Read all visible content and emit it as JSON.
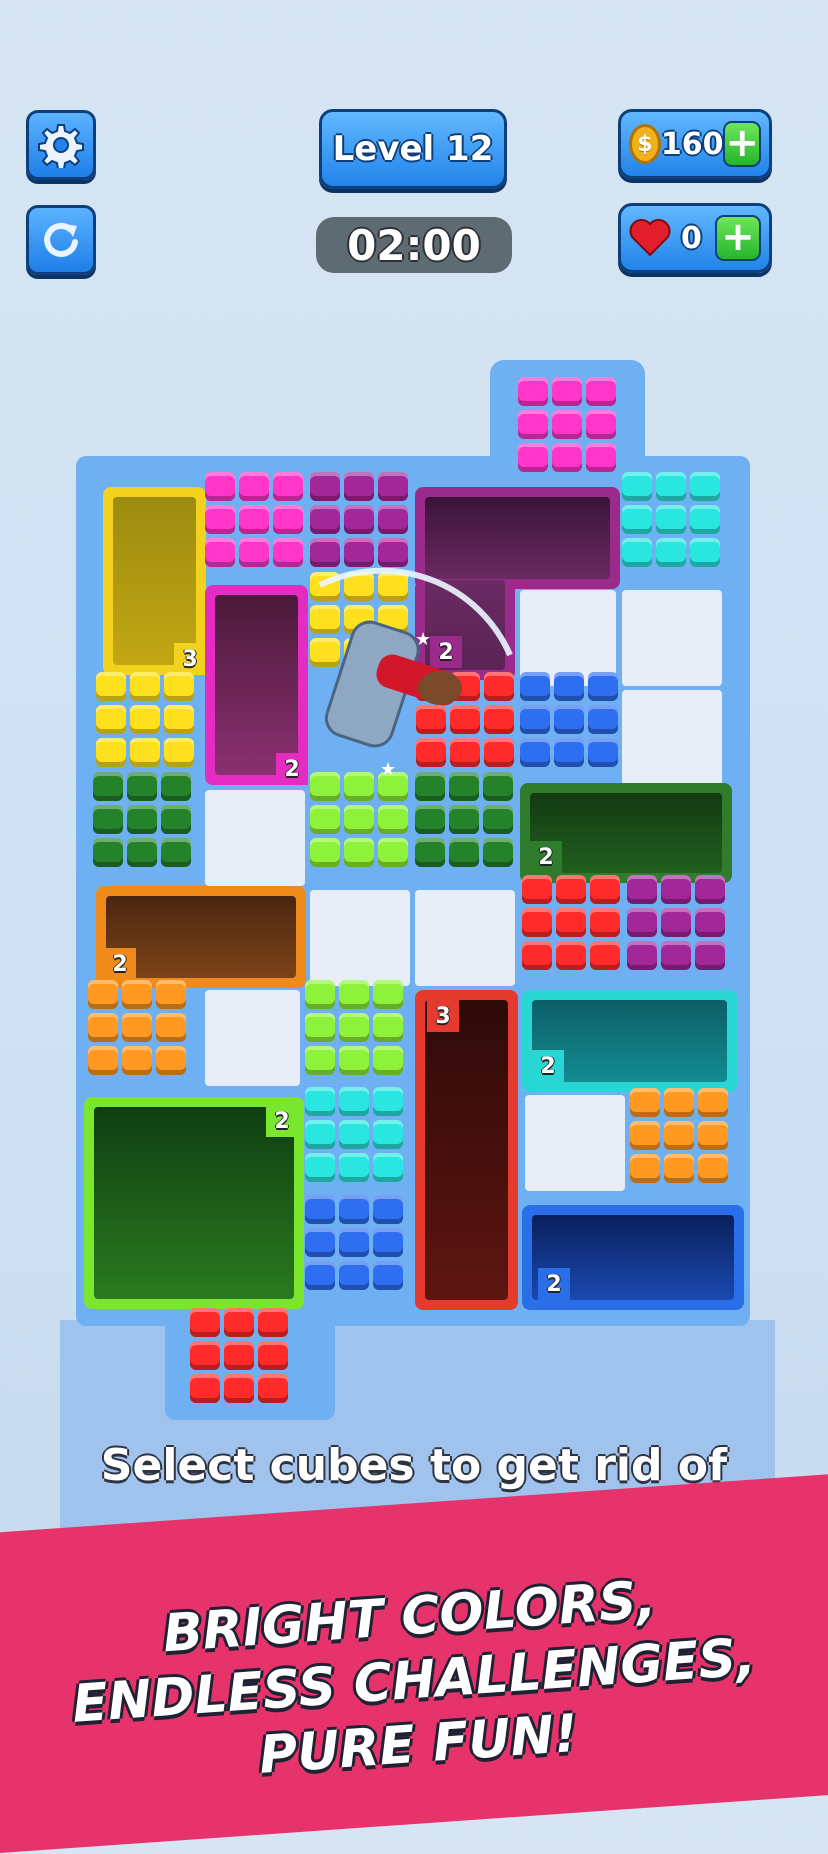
{
  "header": {
    "level_label": "Level 12",
    "timer": "02:00",
    "coins": "160",
    "lives": "0",
    "plus_symbol": "+",
    "coin_symbol": "$"
  },
  "board": {
    "badges": {
      "yellow_box": "3",
      "magenta_box": "2",
      "purple_box": "2",
      "darkgreen_box": "2",
      "brown_box": "2",
      "darkred_box": "3",
      "teal_box": "2",
      "green_box": "2",
      "blue_box": "2"
    }
  },
  "hint_text": "Select cubes to get rid of",
  "promo": {
    "line1": "BRIGHT COLORS,",
    "line2": "ENDLESS CHALLENGES,",
    "line3": "PURE FUN!"
  },
  "colors": {
    "button_blue": "#2284ea",
    "board_blue": "#6fb0f2",
    "banner_pink": "#e7336b"
  }
}
